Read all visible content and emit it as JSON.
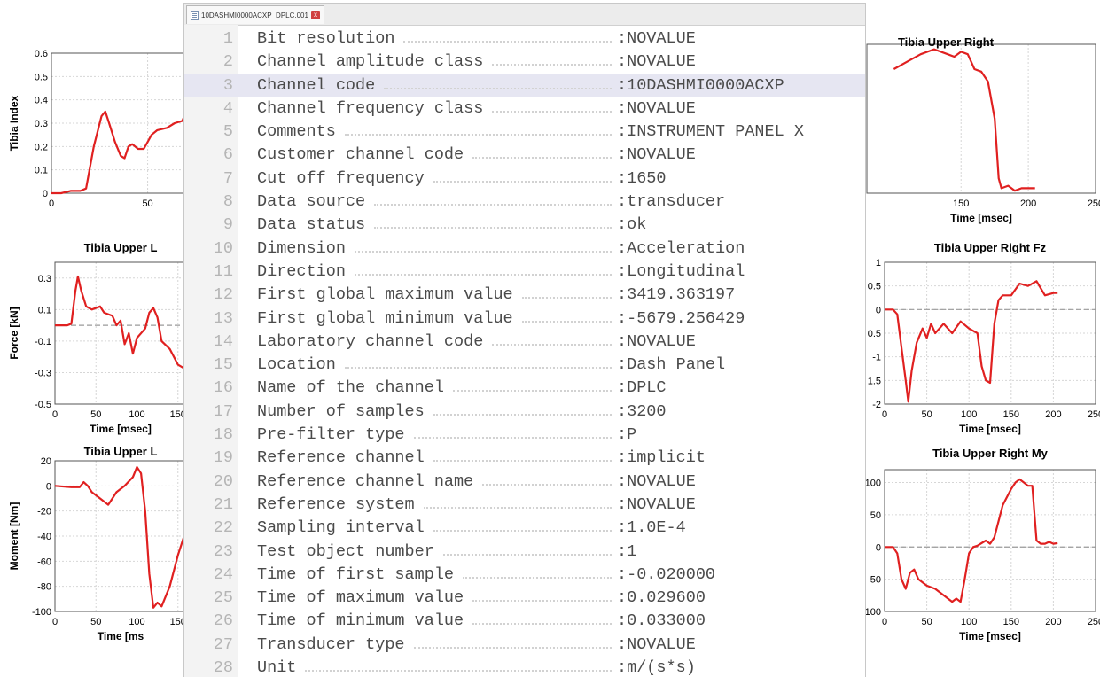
{
  "editor": {
    "tab_label": "10DASHMI0000ACXP_DPLC.001",
    "close_glyph": "x",
    "highlight_color": "#e6e6f2",
    "highlighted_line": 3,
    "rows": [
      {
        "n": "1",
        "key": "Bit resolution",
        "val": ":NOVALUE"
      },
      {
        "n": "2",
        "key": "Channel amplitude class",
        "val": ":NOVALUE"
      },
      {
        "n": "3",
        "key": "Channel code",
        "val": ":10DASHMI0000ACXP"
      },
      {
        "n": "4",
        "key": "Channel frequency class",
        "val": ":NOVALUE"
      },
      {
        "n": "5",
        "key": "Comments",
        "val": ":INSTRUMENT PANEL X"
      },
      {
        "n": "6",
        "key": "Customer channel code",
        "val": ":NOVALUE"
      },
      {
        "n": "7",
        "key": "Cut off frequency",
        "val": ":1650"
      },
      {
        "n": "8",
        "key": "Data source",
        "val": ":transducer"
      },
      {
        "n": "9",
        "key": "Data status",
        "val": ":ok"
      },
      {
        "n": "10",
        "key": "Dimension",
        "val": ":Acceleration"
      },
      {
        "n": "11",
        "key": "Direction",
        "val": ":Longitudinal"
      },
      {
        "n": "12",
        "key": "First global maximum value",
        "val": ":3419.363197"
      },
      {
        "n": "13",
        "key": "First global minimum value",
        "val": ":-5679.256429"
      },
      {
        "n": "14",
        "key": "Laboratory channel code",
        "val": ":NOVALUE"
      },
      {
        "n": "15",
        "key": "Location",
        "val": ":Dash Panel"
      },
      {
        "n": "16",
        "key": "Name of the channel",
        "val": ":DPLC"
      },
      {
        "n": "17",
        "key": "Number of samples",
        "val": ":3200"
      },
      {
        "n": "18",
        "key": "Pre-filter type",
        "val": ":P"
      },
      {
        "n": "19",
        "key": "Reference channel",
        "val": ":implicit"
      },
      {
        "n": "20",
        "key": "Reference channel name",
        "val": ":NOVALUE"
      },
      {
        "n": "21",
        "key": "Reference system",
        "val": ":NOVALUE"
      },
      {
        "n": "22",
        "key": "Sampling interval",
        "val": ":1.0E-4"
      },
      {
        "n": "23",
        "key": "Test object number",
        "val": ":1"
      },
      {
        "n": "24",
        "key": "Time of first sample",
        "val": ":-0.020000"
      },
      {
        "n": "25",
        "key": "Time of maximum value",
        "val": ":0.029600"
      },
      {
        "n": "26",
        "key": "Time of minimum value",
        "val": ":0.033000"
      },
      {
        "n": "27",
        "key": "Transducer type",
        "val": ":NOVALUE"
      },
      {
        "n": "28",
        "key": "Unit",
        "val": ":m/(s*s)"
      }
    ]
  },
  "chart_data": [
    {
      "type": "line",
      "title": "",
      "ylabel": "Tibia Index",
      "xlabel": "",
      "xlim": [
        0,
        70
      ],
      "ylim": [
        0,
        0.6
      ],
      "xticks": [
        0,
        50
      ],
      "yticks": [
        0,
        0.1,
        0.2,
        0.3,
        0.4,
        0.5,
        0.6
      ],
      "ytick_labels": [
        "0",
        "0.1",
        "0.2",
        "0.3",
        "0.4",
        "0.5",
        "0.6"
      ],
      "series": [
        {
          "color": "#e02020",
          "x": [
            0,
            5,
            10,
            15,
            18,
            22,
            26,
            28,
            30,
            33,
            36,
            38,
            40,
            42,
            45,
            48,
            50,
            52,
            55,
            60,
            64,
            68,
            70
          ],
          "y": [
            0,
            0,
            0.01,
            0.01,
            0.02,
            0.2,
            0.33,
            0.35,
            0.3,
            0.22,
            0.16,
            0.15,
            0.2,
            0.21,
            0.19,
            0.19,
            0.22,
            0.25,
            0.27,
            0.28,
            0.3,
            0.31,
            0.35
          ]
        }
      ]
    },
    {
      "type": "line",
      "title": "Tibia Upper L",
      "ylabel": "Force [kN]",
      "xlabel": "Time [msec]",
      "xlim": [
        0,
        160
      ],
      "ylim": [
        -0.5,
        0.4
      ],
      "xticks": [
        0,
        50,
        100,
        150
      ],
      "yticks": [
        -0.5,
        -0.3,
        -0.1,
        0.1,
        0.3
      ],
      "ytick_labels": [
        "-0.5",
        "-0.3",
        "-0.1",
        "0.1",
        "0.3"
      ],
      "zero_line": true,
      "series": [
        {
          "color": "#e02020",
          "x": [
            0,
            10,
            15,
            20,
            25,
            28,
            32,
            38,
            45,
            55,
            60,
            70,
            75,
            80,
            85,
            90,
            95,
            100,
            110,
            115,
            120,
            125,
            130,
            140,
            150,
            160
          ],
          "y": [
            0,
            0,
            0,
            0.01,
            0.22,
            0.31,
            0.22,
            0.12,
            0.1,
            0.12,
            0.08,
            0.06,
            0,
            0.03,
            -0.12,
            -0.05,
            -0.18,
            -0.08,
            -0.02,
            0.08,
            0.11,
            0.05,
            -0.1,
            -0.15,
            -0.25,
            -0.28
          ]
        }
      ]
    },
    {
      "type": "line",
      "title": "Tibia Upper L",
      "ylabel": "Moment [Nm]",
      "xlabel": "Time [ms",
      "xlim": [
        0,
        160
      ],
      "ylim": [
        -100,
        20
      ],
      "xticks": [
        0,
        50,
        100,
        150
      ],
      "yticks": [
        -100,
        -80,
        -60,
        -40,
        -20,
        0,
        20
      ],
      "ytick_labels": [
        "-100",
        "-80",
        "-60",
        "-40",
        "-20",
        "0",
        "20"
      ],
      "series": [
        {
          "color": "#e02020",
          "x": [
            0,
            20,
            30,
            35,
            40,
            45,
            55,
            65,
            70,
            75,
            85,
            95,
            100,
            105,
            110,
            115,
            120,
            125,
            130,
            140,
            150,
            160
          ],
          "y": [
            0,
            -1,
            -1,
            3,
            0,
            -5,
            -10,
            -15,
            -10,
            -5,
            0,
            7,
            15,
            10,
            -20,
            -70,
            -97,
            -93,
            -96,
            -80,
            -55,
            -35
          ]
        }
      ]
    },
    {
      "type": "line",
      "title": "Tibia Upper Right",
      "ylabel": "",
      "xlabel": "Time [msec]",
      "xlim": [
        80,
        250
      ],
      "ylim": [
        0,
        0.6
      ],
      "xticks": [
        150,
        200,
        250
      ],
      "series": [
        {
          "color": "#e02020",
          "x": [
            100,
            110,
            120,
            130,
            140,
            145,
            150,
            155,
            160,
            165,
            170,
            175,
            178,
            180,
            185,
            190,
            195,
            200,
            205
          ],
          "y": [
            0.5,
            0.53,
            0.56,
            0.58,
            0.56,
            0.55,
            0.57,
            0.56,
            0.5,
            0.49,
            0.45,
            0.3,
            0.06,
            0.02,
            0.03,
            0.01,
            0.02,
            0.02,
            0.02
          ]
        }
      ]
    },
    {
      "type": "line",
      "title": "Tibia Upper Right Fz",
      "ylabel": "",
      "xlabel": "Time [msec]",
      "xlim": [
        0,
        250
      ],
      "ylim": [
        -2,
        1
      ],
      "xticks": [
        0,
        50,
        100,
        150,
        200,
        250
      ],
      "yticks": [
        -2,
        -1.5,
        -1,
        -0.5,
        0,
        0.5,
        1
      ],
      "ytick_labels": [
        "-2",
        "1.5",
        "-1",
        "0.5",
        "0",
        "0.5",
        "1"
      ],
      "zero_line": true,
      "series": [
        {
          "color": "#e02020",
          "x": [
            0,
            10,
            15,
            20,
            25,
            28,
            32,
            38,
            45,
            50,
            55,
            60,
            70,
            80,
            90,
            100,
            110,
            115,
            120,
            125,
            130,
            135,
            140,
            150,
            160,
            170,
            180,
            190,
            200,
            205
          ],
          "y": [
            0,
            0,
            -0.1,
            -0.8,
            -1.5,
            -1.95,
            -1.3,
            -0.7,
            -0.4,
            -0.6,
            -0.3,
            -0.5,
            -0.3,
            -0.5,
            -0.25,
            -0.4,
            -0.5,
            -1.2,
            -1.5,
            -1.55,
            -0.3,
            0.2,
            0.3,
            0.3,
            0.55,
            0.5,
            0.6,
            0.3,
            0.35,
            0.35
          ]
        }
      ]
    },
    {
      "type": "line",
      "title": "Tibia Upper Right My",
      "ylabel": "",
      "xlabel": "Time [msec]",
      "xlim": [
        0,
        250
      ],
      "ylim": [
        -100,
        120
      ],
      "xticks": [
        0,
        50,
        100,
        150,
        200,
        250
      ],
      "yticks": [
        -100,
        -50,
        0,
        50,
        100
      ],
      "ytick_labels": [
        "100",
        "-50",
        "0",
        "50",
        "100"
      ],
      "zero_line": true,
      "series": [
        {
          "color": "#e02020",
          "x": [
            0,
            10,
            15,
            20,
            25,
            30,
            35,
            40,
            50,
            60,
            70,
            80,
            85,
            90,
            95,
            100,
            105,
            110,
            120,
            125,
            130,
            140,
            150,
            155,
            160,
            165,
            170,
            175,
            180,
            185,
            190,
            195,
            200,
            205
          ],
          "y": [
            0,
            0,
            -10,
            -50,
            -65,
            -40,
            -35,
            -50,
            -60,
            -65,
            -75,
            -85,
            -80,
            -85,
            -50,
            -10,
            0,
            2,
            10,
            5,
            15,
            65,
            90,
            100,
            105,
            100,
            95,
            95,
            10,
            5,
            5,
            8,
            5,
            6
          ]
        }
      ]
    }
  ]
}
